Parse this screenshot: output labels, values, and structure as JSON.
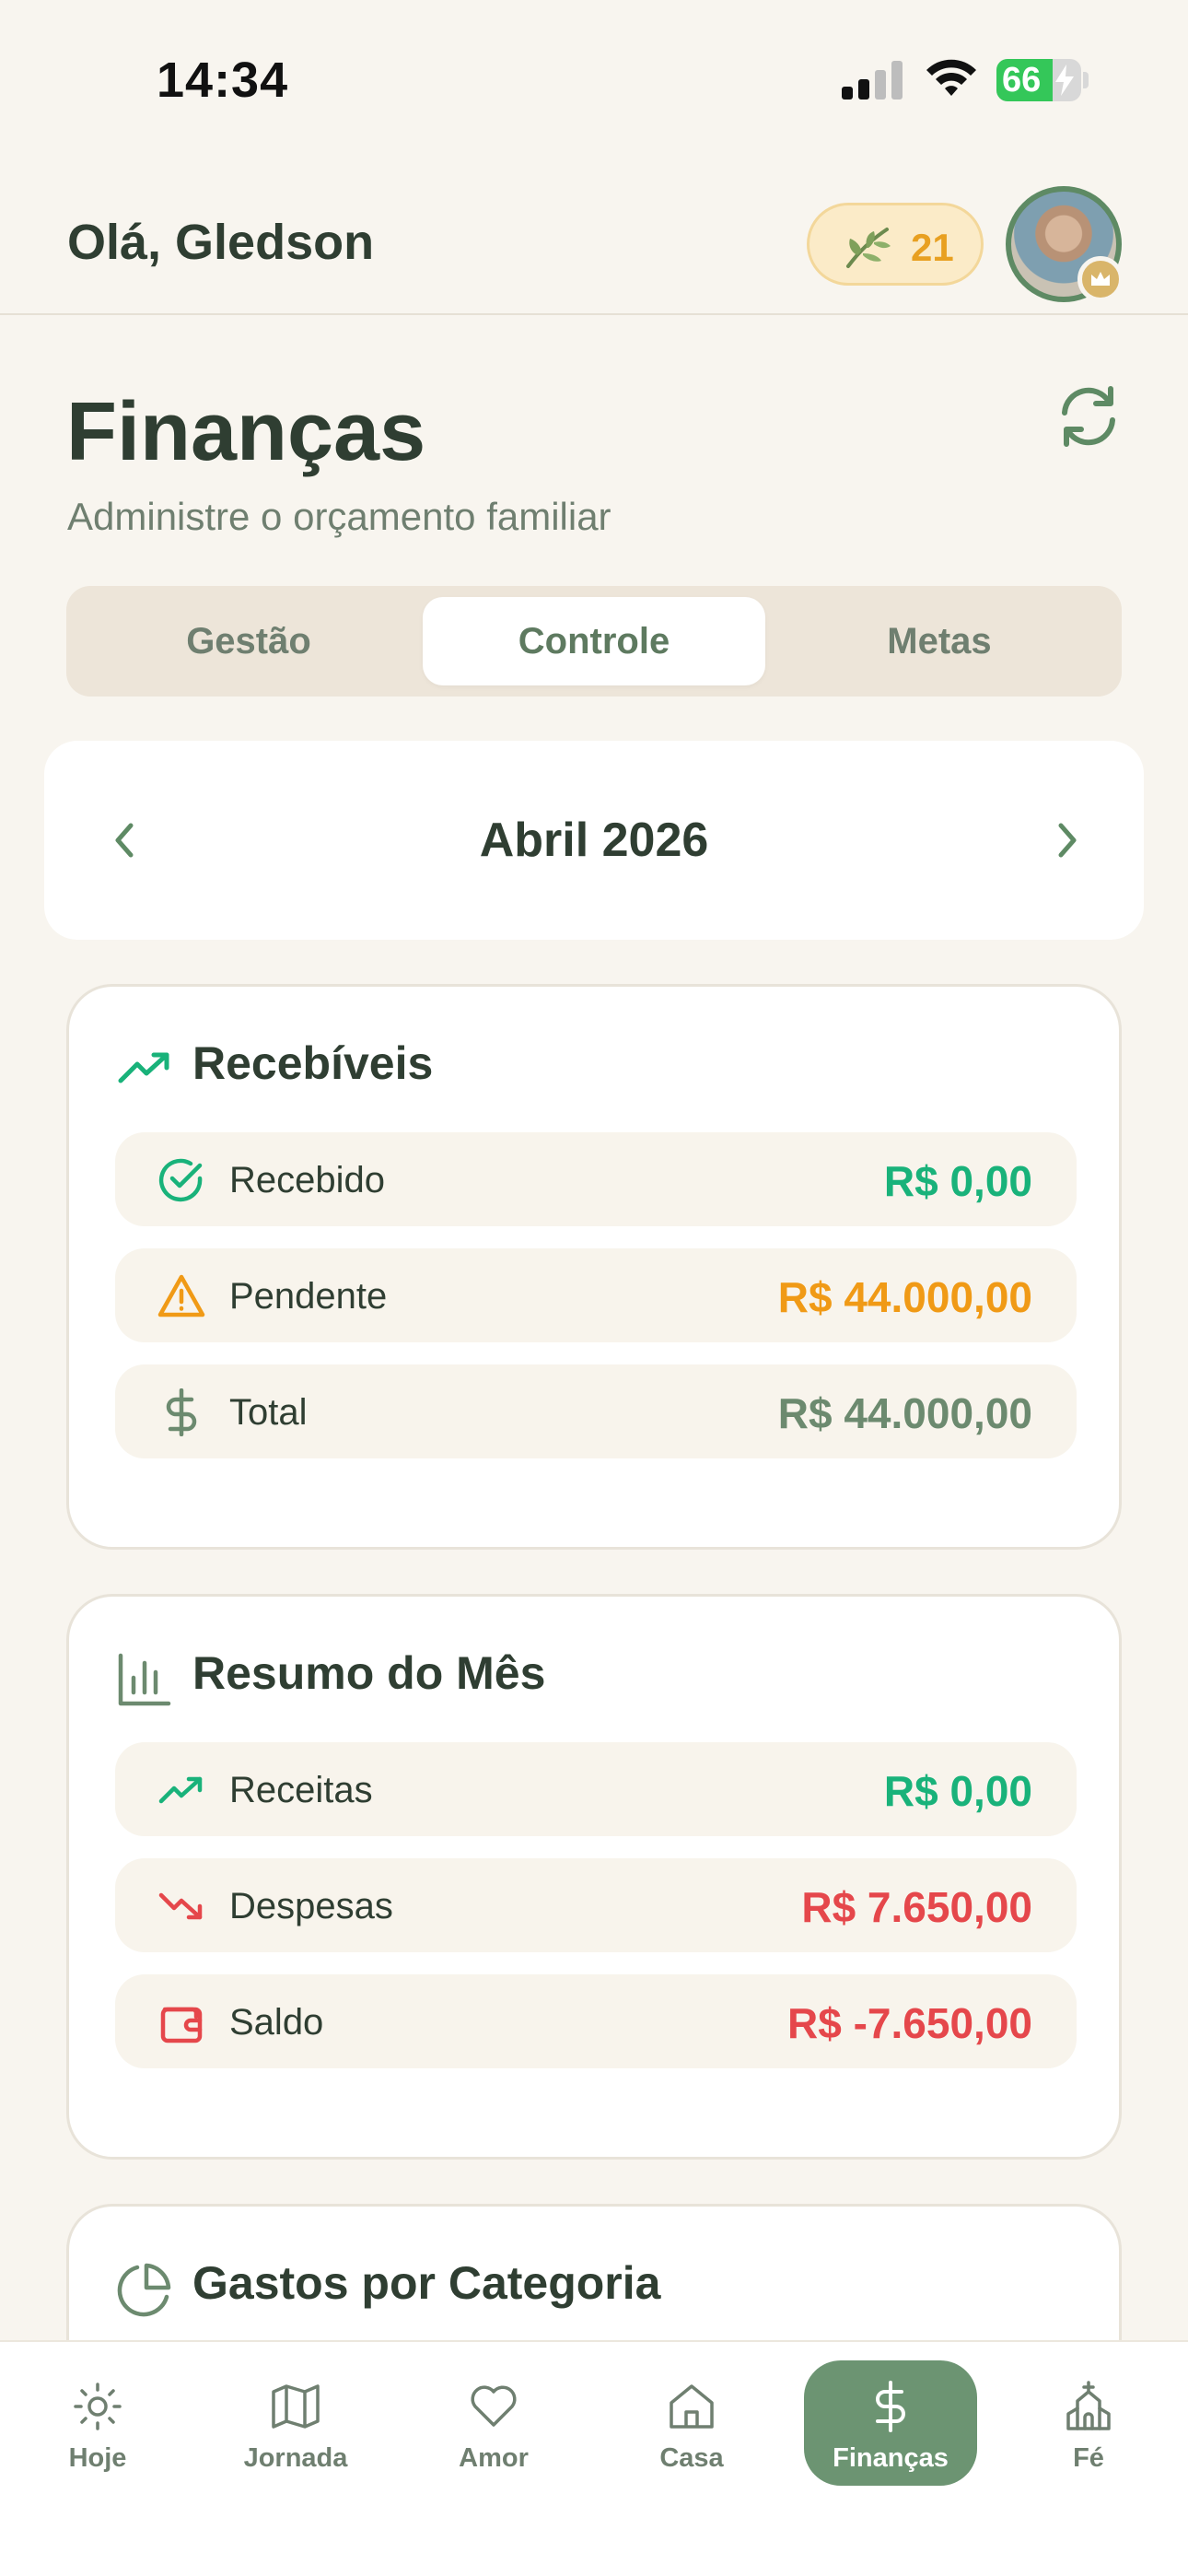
{
  "status_bar": {
    "time": "14:34",
    "battery": "66"
  },
  "header": {
    "greeting": "Olá, Gledson",
    "points": "21"
  },
  "page": {
    "title": "Finanças",
    "subtitle": "Administre o orçamento familiar"
  },
  "tabs": [
    {
      "label": "Gestão",
      "active": false
    },
    {
      "label": "Controle",
      "active": true
    },
    {
      "label": "Metas",
      "active": false
    }
  ],
  "month_selector": {
    "label": "Abril 2026"
  },
  "receivables": {
    "title": "Recebíveis",
    "rows": [
      {
        "label": "Recebido",
        "value": "R$ 0,00",
        "color": "#19B27A",
        "icon": "check-circle-icon"
      },
      {
        "label": "Pendente",
        "value": "R$ 44.000,00",
        "color": "#F09A16",
        "icon": "warning-triangle-icon"
      },
      {
        "label": "Total",
        "value": "R$ 44.000,00",
        "color": "#6C8A6F",
        "icon": "dollar-icon"
      }
    ]
  },
  "month_summary": {
    "title": "Resumo do Mês",
    "rows": [
      {
        "label": "Receitas",
        "value": "R$ 0,00",
        "color": "#19B27A",
        "icon": "trending-up-icon"
      },
      {
        "label": "Despesas",
        "value": "R$ 7.650,00",
        "color": "#E5474B",
        "icon": "trending-down-icon"
      },
      {
        "label": "Saldo",
        "value": "R$ -7.650,00",
        "color": "#E5474B",
        "icon": "wallet-icon"
      }
    ]
  },
  "category_spending": {
    "title": "Gastos por Categoria"
  },
  "bottom_nav": [
    {
      "label": "Hoje",
      "icon": "sun-icon",
      "active": false
    },
    {
      "label": "Jornada",
      "icon": "map-icon",
      "active": false
    },
    {
      "label": "Amor",
      "icon": "heart-icon",
      "active": false
    },
    {
      "label": "Casa",
      "icon": "home-icon",
      "active": false
    },
    {
      "label": "Finanças",
      "icon": "dollar-icon",
      "active": true
    },
    {
      "label": "Fé",
      "icon": "church-icon",
      "active": false
    }
  ],
  "colors": {
    "background": "#F8F5EF",
    "primary_green": "#6C9472",
    "text_dark": "#2F3E32",
    "positive": "#19B27A",
    "negative": "#E5474B",
    "warning": "#F09A16"
  }
}
